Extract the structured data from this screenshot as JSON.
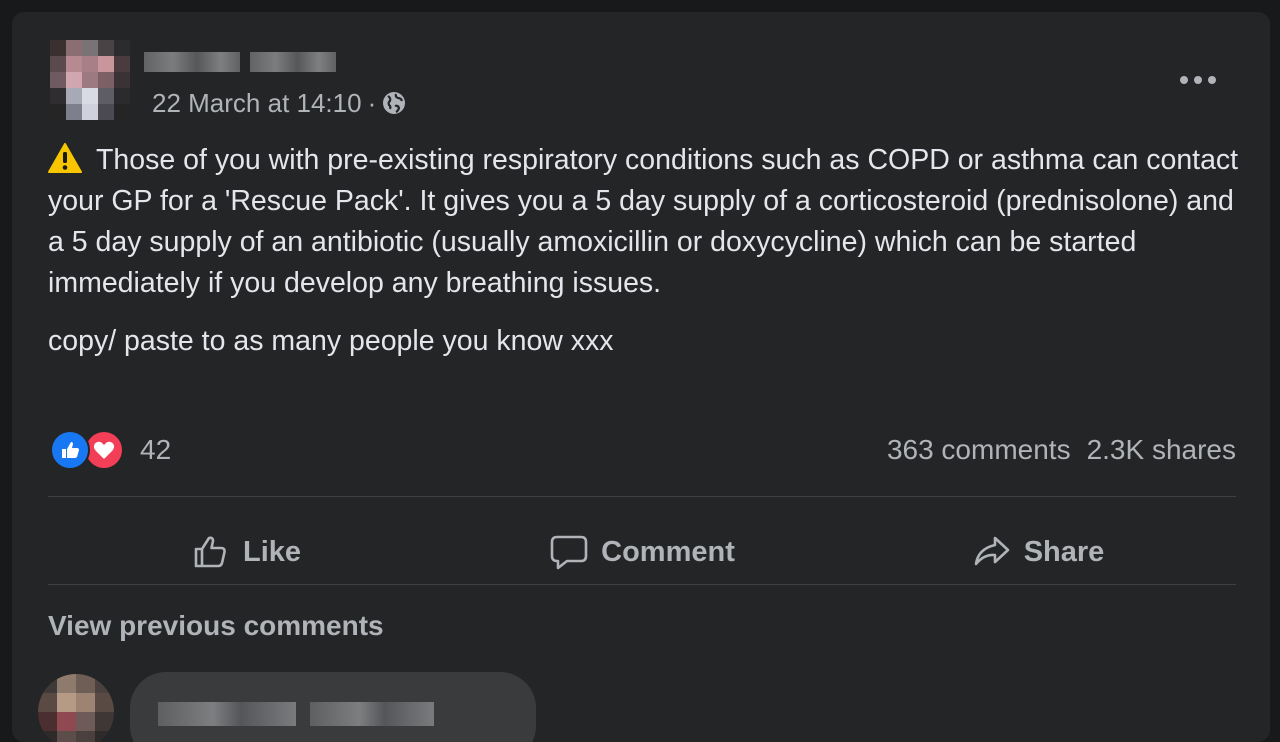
{
  "post": {
    "timestamp": "22 March at 14:10",
    "separator": "·",
    "visibility_icon": "globe-icon",
    "more_icon": "more-horizontal-icon",
    "warning_icon": "warning-icon",
    "text_paragraph_1": "Those of you with pre-existing respiratory conditions such as COPD or asthma can contact your GP for a 'Rescue Pack'. It gives you a 5 day supply of a corticosteroid (prednisolone) and a 5 day supply of an antibiotic (usually amoxicillin or doxycycline) which can be started immediately if you develop any breathing issues.",
    "text_paragraph_2": "copy/ paste to as many people you know xxx"
  },
  "stats": {
    "reaction_icons": [
      "like-icon",
      "love-icon"
    ],
    "reaction_count": "42",
    "comments": "363 comments",
    "shares": "2.3K shares"
  },
  "actions": {
    "like_label": "Like",
    "comment_label": "Comment",
    "share_label": "Share"
  },
  "comments": {
    "view_previous_label": "View previous comments"
  },
  "colors": {
    "background": "#18191a",
    "card": "#242526",
    "primary_text": "#e4e6eb",
    "secondary_text": "#b0b3b8",
    "like_blue": "#1877f2",
    "love_red": "#f33e58",
    "warning_yellow": "#f7c600"
  }
}
